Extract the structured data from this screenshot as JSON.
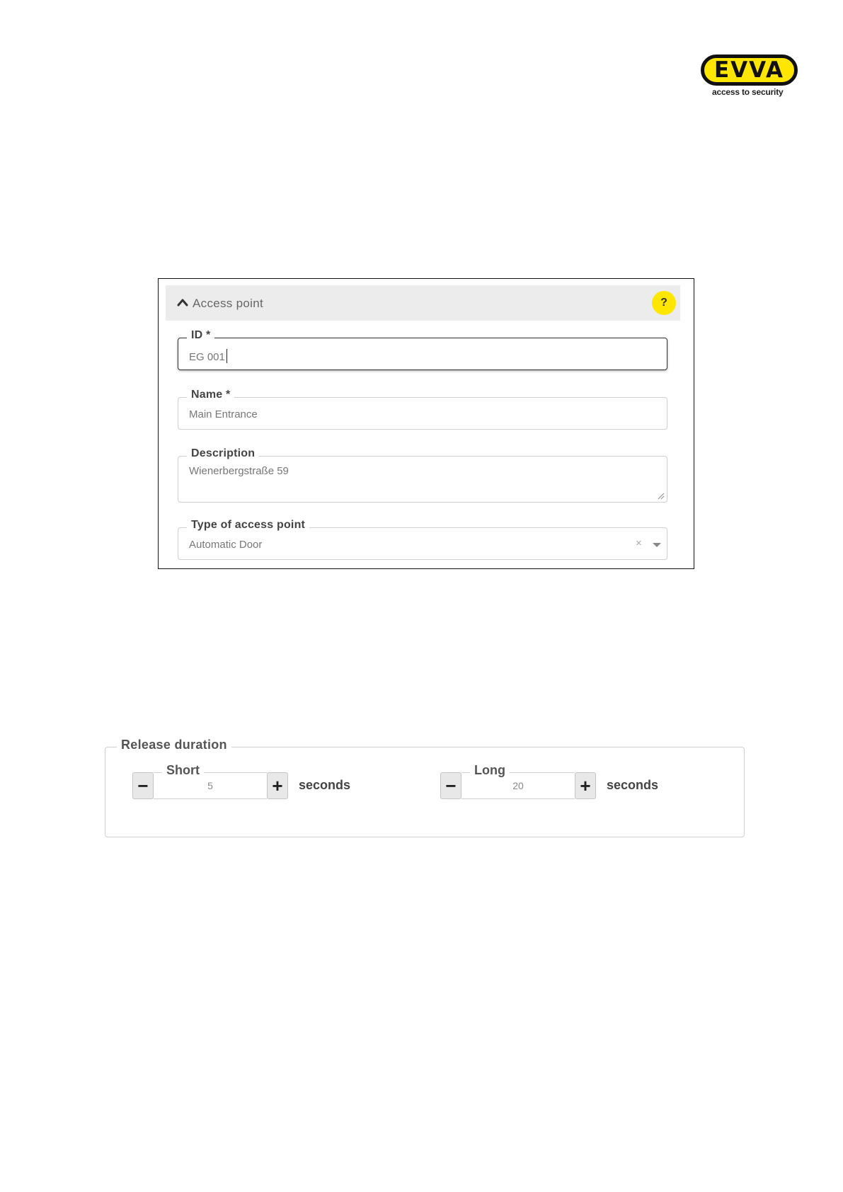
{
  "logo": {
    "wordmark": "EVVA",
    "tagline": "access to security"
  },
  "access_point_panel": {
    "header_title": "Access point",
    "help_label": "?",
    "fields": {
      "id": {
        "label": "ID *",
        "value": "EG 001"
      },
      "name": {
        "label": "Name *",
        "value": "Main Entrance"
      },
      "description": {
        "label": "Description",
        "value": "Wienerbergstraße 59"
      },
      "type": {
        "label": "Type of access point",
        "value": "Automatic Door",
        "clear_label": "×"
      }
    }
  },
  "release_duration": {
    "label": "Release duration",
    "short": {
      "label": "Short",
      "value": "5",
      "unit": "seconds",
      "minus": "−",
      "plus": "+"
    },
    "long": {
      "label": "Long",
      "value": "20",
      "unit": "seconds",
      "minus": "−",
      "plus": "+"
    }
  },
  "colors": {
    "brand_yellow": "#ffe600",
    "header_gray": "#ececec"
  }
}
